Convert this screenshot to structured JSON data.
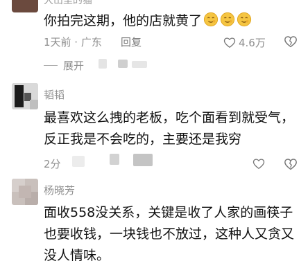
{
  "top_comment": {
    "username": "大山里的猫",
    "text": "你拍完这期，他的店就黄了",
    "emoji_count": 3,
    "time_location": "1天前 · 广东",
    "reply": "回复",
    "likes": "4.6万",
    "expand_label": "展开"
  },
  "comments": [
    {
      "username": "韬韬",
      "text": "最喜欢这么拽的老板，吃个面看到就受气，反正我是不会吃的，主要还是我穷",
      "time": "2分"
    },
    {
      "username": "杨晓芳",
      "text": "面收558没关系，关键是收了人家的画筷子也要收钱，一块钱也不放过，这种人又贪又没人情味。"
    }
  ],
  "colors": {
    "text": "#111111",
    "meta": "#8e8e8e",
    "emoji": "#f5c542"
  }
}
